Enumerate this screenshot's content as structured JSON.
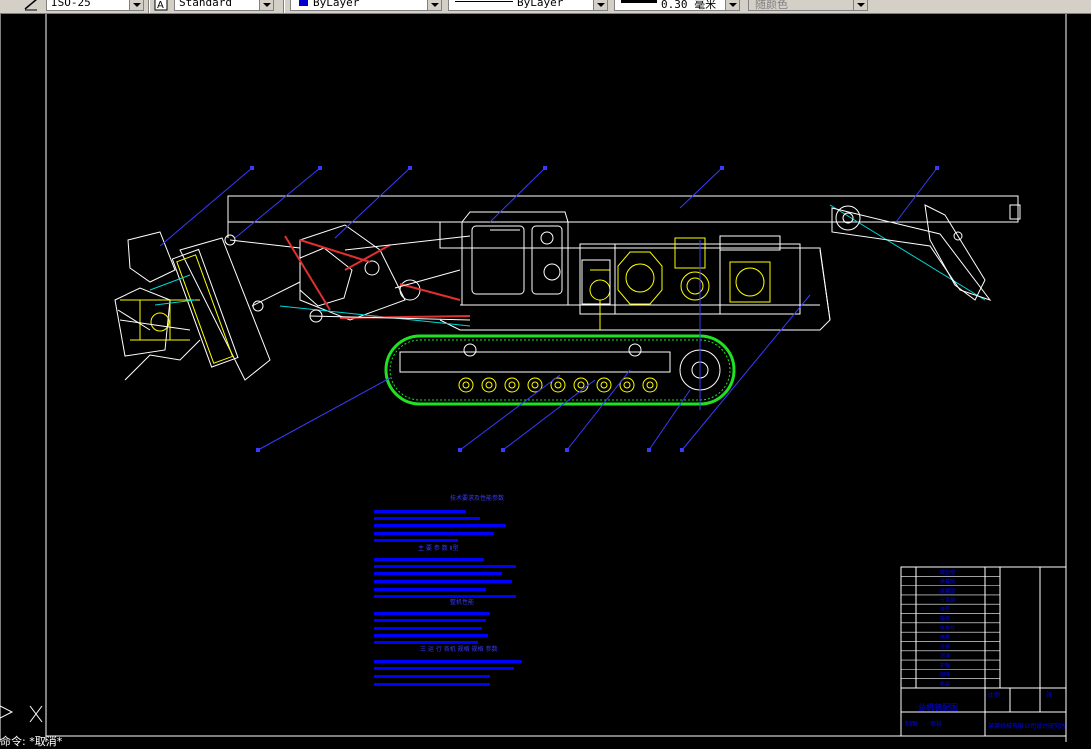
{
  "toolbar": {
    "dimstyle_value": "ISO-25",
    "textstyle_value": "Standard",
    "color_value": "ByLayer",
    "linetype_value": "ByLayer",
    "lineweight_value": "0.30 毫米",
    "plotstyle_value": "随颜色"
  },
  "drawing": {
    "notes_title": "技术要求及性能参数",
    "notes_sub1": "主  要  参  数    Ⅱ型",
    "notes_sub2": "整机性能",
    "notes_sub3": "三  运  行    各机  规格  规格  参数",
    "title_block": {
      "drawing_name": "总机装配图",
      "scale_label": "比例",
      "sheet_label": "张",
      "drawn_label": "制图",
      "checked_label": "审核",
      "company": "某某机械有限公司设计研究所",
      "part_rows": [
        "截割部",
        "装载部",
        "运输部",
        "行走部",
        "液压",
        "电气",
        "操纵台",
        "喷雾",
        "冷却",
        "润滑",
        "护板",
        "附件",
        "机架"
      ]
    }
  },
  "command_line": "命令: *取消*",
  "colors": {
    "machine_outline": "#ffffff",
    "track": "#22e022",
    "leader": "#3a3aff",
    "hydraulic": "#e03030",
    "detail": "#ffff00",
    "cyan": "#00d8d8"
  }
}
